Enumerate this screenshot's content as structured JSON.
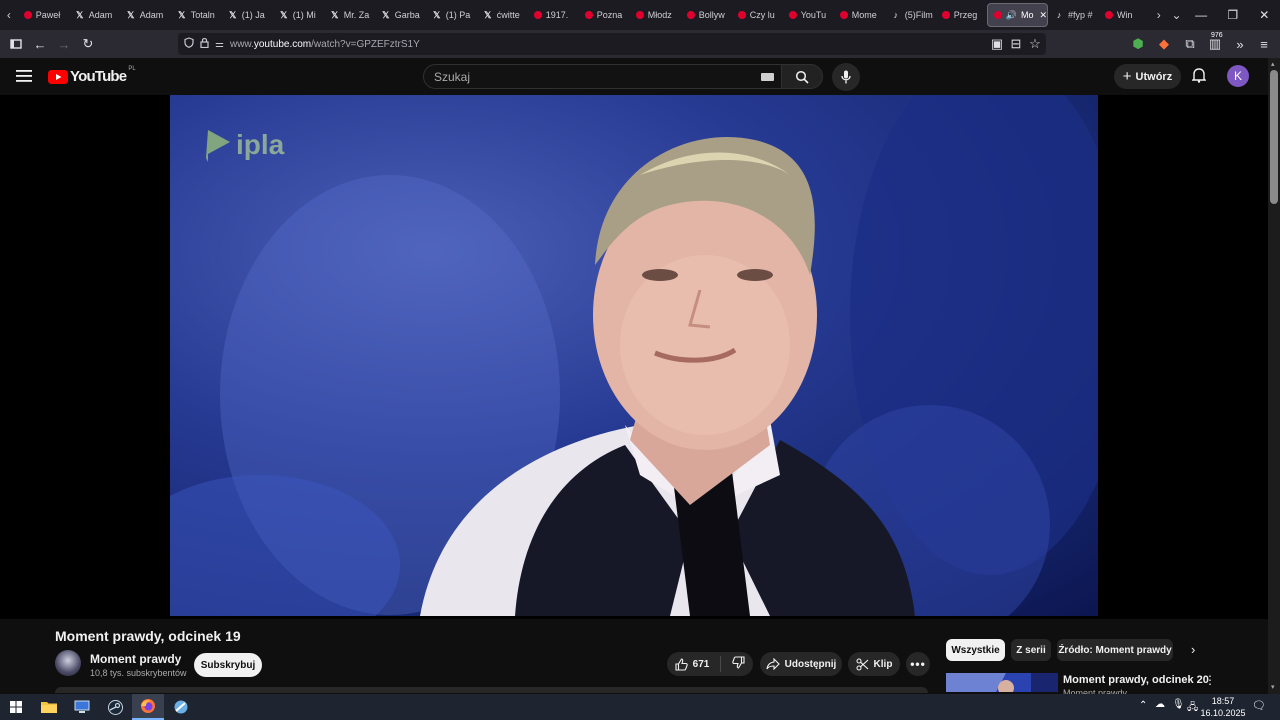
{
  "browser": {
    "tabs": [
      {
        "label": "Paweł",
        "icon": "youtube"
      },
      {
        "label": "Adam",
        "icon": "x"
      },
      {
        "label": "Adam",
        "icon": "x"
      },
      {
        "label": "Totaln",
        "icon": "x"
      },
      {
        "label": "(1) Ja",
        "icon": "x"
      },
      {
        "label": "(1) Mi",
        "icon": "x"
      },
      {
        "label": "Mr. Za",
        "icon": "x"
      },
      {
        "label": "Garba",
        "icon": "x"
      },
      {
        "label": "(1) Pa",
        "icon": "x"
      },
      {
        "label": "ćwitte",
        "icon": "x"
      },
      {
        "label": "1917.",
        "icon": "youtube"
      },
      {
        "label": "Pozna",
        "icon": "youtube"
      },
      {
        "label": "Młodz",
        "icon": "youtube"
      },
      {
        "label": "Bollyw",
        "icon": "youtube"
      },
      {
        "label": "Czy lu",
        "icon": "youtube"
      },
      {
        "label": "YouTu",
        "icon": "youtube"
      },
      {
        "label": "Mome",
        "icon": "youtube"
      },
      {
        "label": "(5)Film",
        "icon": "tiktok"
      },
      {
        "label": "Przeg",
        "icon": "youtube"
      }
    ],
    "active_tab": {
      "label": "Mo",
      "icon": "youtube"
    },
    "tabs_after": [
      {
        "label": "#fyp #",
        "icon": "tiktok"
      },
      {
        "label": "Win",
        "icon": "youtube"
      }
    ],
    "url_prefix": "www.",
    "url_domain": "youtube.com",
    "url_path": "/watch?v=GPZEFztrS1Y",
    "extension_badge": "976"
  },
  "youtube": {
    "logo_text": "YouTube",
    "region": "PL",
    "search_placeholder": "Szukaj",
    "create_label": "Utwórz",
    "avatar_letter": "K",
    "watermark": "ipla"
  },
  "video": {
    "title": "Moment prawdy, odcinek 19",
    "channel_name": "Moment prawdy",
    "subscribers": "10,8 tys. subskrybentów",
    "subscribe_label": "Subskrybuj",
    "likes": "671",
    "share_label": "Udostępnij",
    "clip_label": "Klip"
  },
  "sidebar": {
    "chips": [
      "Wszystkie",
      "Z serii",
      "Źródło: Moment prawdy"
    ],
    "related": {
      "title": "Moment prawdy, odcinek 20",
      "channel": "Moment prawdy"
    }
  },
  "taskbar": {
    "time": "18:57",
    "date": "16.10.2025"
  },
  "colors": {
    "youtube_red": "#ff0000",
    "avatar_purple": "#7e57c2",
    "background": "#0f0f0f"
  }
}
